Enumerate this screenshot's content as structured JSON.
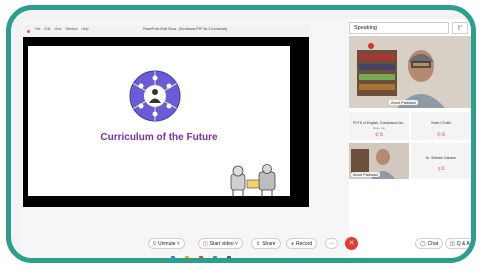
{
  "powerpoint": {
    "menu": [
      "File",
      "Edit",
      "View",
      "Window",
      "Help"
    ],
    "window_title": "PowerPoint Slide Show - [Goodwana PSF No.3 Curriculum]"
  },
  "slide": {
    "title": "Curriculum of the Future"
  },
  "panel": {
    "speaking_label": "Speaking",
    "main_speaker": "Amol Padwad",
    "tiles": [
      {
        "name": "PGTD of English, Gondwana Uni...",
        "sub": "Host, me"
      },
      {
        "name": "Vivek V Kulhi",
        "sub": ""
      },
      {
        "name": "Amol Padwad",
        "sub": ""
      },
      {
        "name": "Dr. Shriram Gahane",
        "sub": ""
      }
    ]
  },
  "controls": {
    "unmute": "Unmute",
    "start_video": "Start video",
    "share": "Share",
    "record": "Record",
    "more": "···",
    "leave": "✕",
    "chat": "Chat",
    "qa": "Q & A"
  },
  "colors": {
    "frame": "#2c9f8c",
    "slide_title": "#7b2fa3",
    "leave": "#e53935"
  }
}
